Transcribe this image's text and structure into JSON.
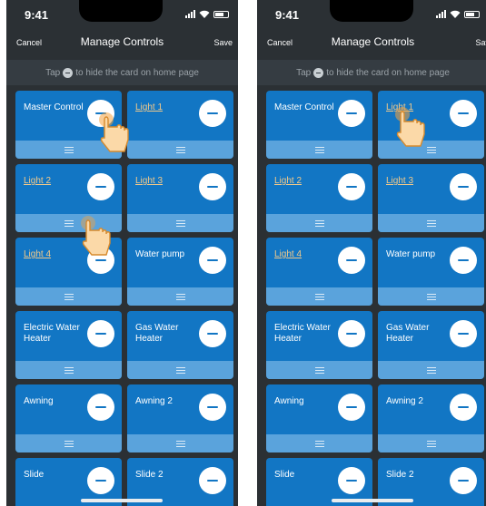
{
  "screens": [
    {
      "status_time": "9:41",
      "nav": {
        "cancel": "Cancel",
        "title": "Manage Controls",
        "save": "Save"
      },
      "hint": {
        "before": "Tap",
        "after": "to hide the card on home page"
      },
      "cards": [
        {
          "label": "Master Control",
          "link": false
        },
        {
          "label": "Light 1",
          "link": true
        },
        {
          "label": "Light 2",
          "link": true
        },
        {
          "label": "Light 3",
          "link": true
        },
        {
          "label": "Light 4",
          "link": true
        },
        {
          "label": "Water pump",
          "link": false
        },
        {
          "label": "Electric Water Heater",
          "link": false
        },
        {
          "label": "Gas Water Heater",
          "link": false
        },
        {
          "label": "Awning",
          "link": false
        },
        {
          "label": "Awning 2",
          "link": false
        },
        {
          "label": "Slide",
          "link": false
        },
        {
          "label": "Slide 2",
          "link": false
        }
      ]
    },
    {
      "status_time": "9:41",
      "nav": {
        "cancel": "Cancel",
        "title": "Manage Controls",
        "save": "Save"
      },
      "hint": {
        "before": "Tap",
        "after": "to hide the card on home page"
      },
      "cards": [
        {
          "label": "Master Control",
          "link": false
        },
        {
          "label": "Light 1",
          "link": true
        },
        {
          "label": "Light 2",
          "link": true
        },
        {
          "label": "Light 3",
          "link": true
        },
        {
          "label": "Light 4",
          "link": true
        },
        {
          "label": "Water pump",
          "link": false
        },
        {
          "label": "Electric Water Heater",
          "link": false
        },
        {
          "label": "Gas Water Heater",
          "link": false
        },
        {
          "label": "Awning",
          "link": false
        },
        {
          "label": "Awning 2",
          "link": false
        },
        {
          "label": "Slide",
          "link": false
        },
        {
          "label": "Slide 2",
          "link": false
        }
      ]
    }
  ],
  "colors": {
    "background": "#2b3034",
    "hint_bar": "#353c42",
    "card": "#1276c4",
    "card_handle": "#5aa3dc",
    "link_text": "#f2c98a"
  },
  "icons": [
    "signal-icon",
    "wifi-icon",
    "battery-icon",
    "minus-circle-icon",
    "drag-handle-icon",
    "tap-hand-icon"
  ]
}
